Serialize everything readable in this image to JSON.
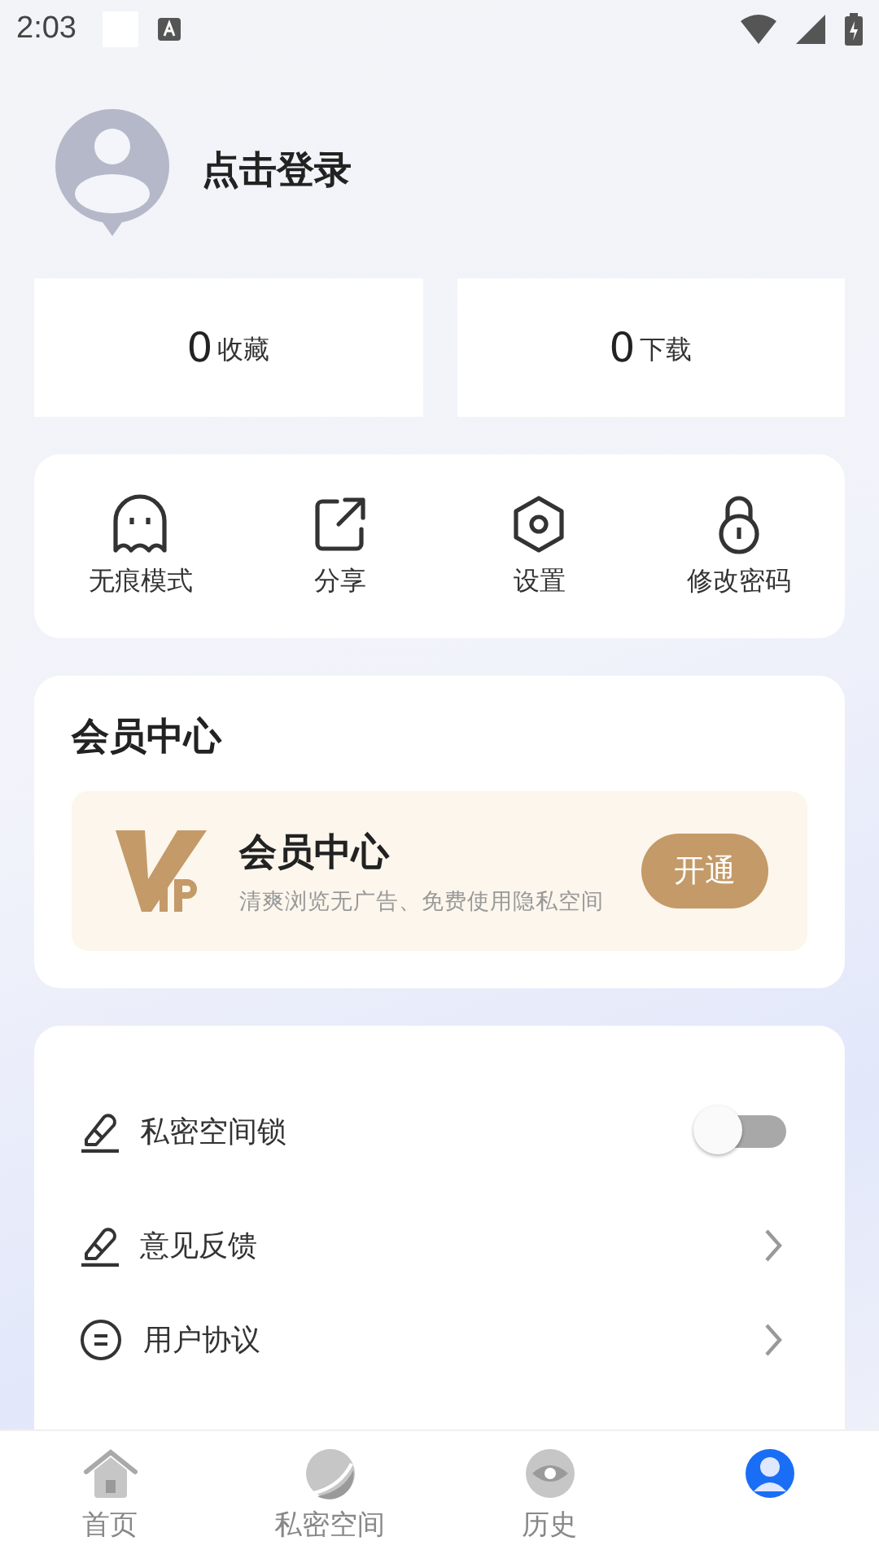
{
  "status_bar": {
    "time": "2:03"
  },
  "profile": {
    "name": "点击登录"
  },
  "stats": [
    {
      "count": "0",
      "label": "收藏"
    },
    {
      "count": "0",
      "label": "下载"
    }
  ],
  "tools": [
    {
      "kind": "ghost",
      "label": "无痕模式"
    },
    {
      "kind": "share",
      "label": "分享"
    },
    {
      "kind": "settings",
      "label": "设置"
    },
    {
      "kind": "lock",
      "label": "修改密码"
    }
  ],
  "member": {
    "title": "会员中心",
    "card_title": "会员中心",
    "subtitle": "清爽浏览无广告、免费使用隐私空间",
    "button": "开通"
  },
  "settings": [
    {
      "kind": "toggle",
      "label": "私密空间锁",
      "on": false
    },
    {
      "kind": "link",
      "label": "意见反馈"
    },
    {
      "kind": "link",
      "label": "用户协议"
    }
  ],
  "tabs": [
    {
      "kind": "home",
      "label": "首页",
      "selected": false
    },
    {
      "kind": "planet",
      "label": "私密空间",
      "selected": false
    },
    {
      "kind": "eye",
      "label": "历史",
      "selected": false
    },
    {
      "kind": "user",
      "selected": true
    }
  ]
}
